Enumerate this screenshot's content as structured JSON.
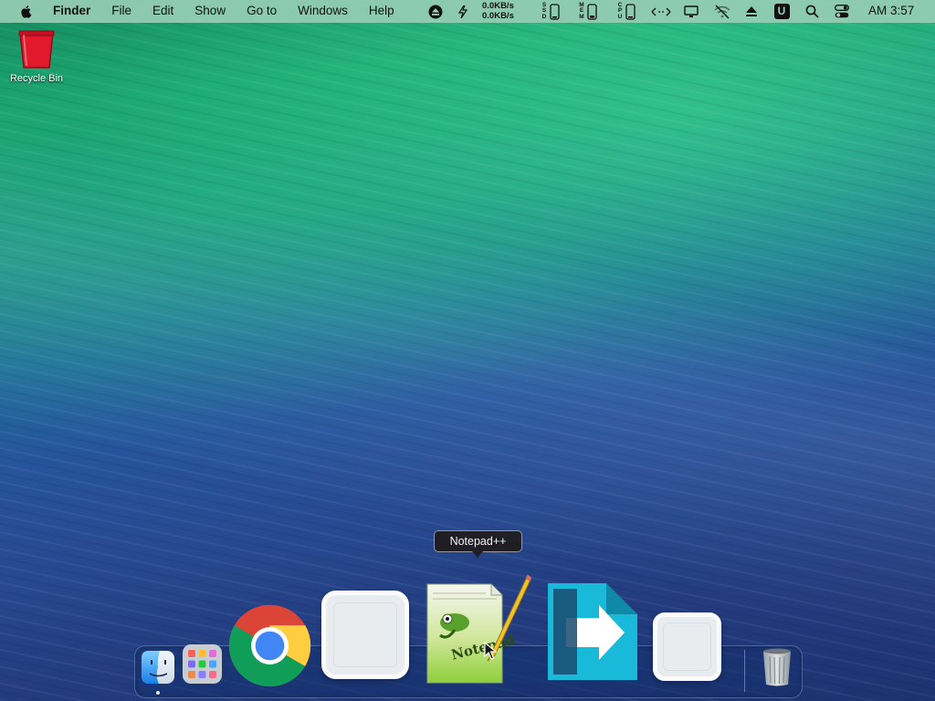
{
  "menubar": {
    "menus": [
      "Finder",
      "File",
      "Edit",
      "Show",
      "Go to",
      "Windows",
      "Help"
    ],
    "net_up": "0.0KB/s",
    "net_down": "0.0KB/s",
    "label_ssd": "SSD",
    "label_mem": "MEM",
    "label_cpu": "CPU",
    "account_letter": "U",
    "time": "AM 3:57"
  },
  "desktop": {
    "recycle_bin_label": "Recycle Bin"
  },
  "dock": {
    "tooltip": "Notepad++",
    "items": [
      {
        "name": "finder-icon",
        "running": true
      },
      {
        "name": "launchpad-icon",
        "running": false
      },
      {
        "name": "chrome-icon",
        "running": false
      },
      {
        "name": "blank-app-icon",
        "running": false
      },
      {
        "name": "notepad-plus-plus-icon",
        "running": false
      },
      {
        "name": "migration-arrow-icon",
        "running": false
      },
      {
        "name": "blank-app-icon",
        "running": false
      },
      {
        "name": "trash-icon",
        "running": false
      }
    ]
  },
  "colors": {
    "menubar_bg": "#96cdb4",
    "tooltip_bg": "#1e1e24",
    "recycle_red": "#e0192c",
    "migration_cyan": "#19b9d9"
  }
}
